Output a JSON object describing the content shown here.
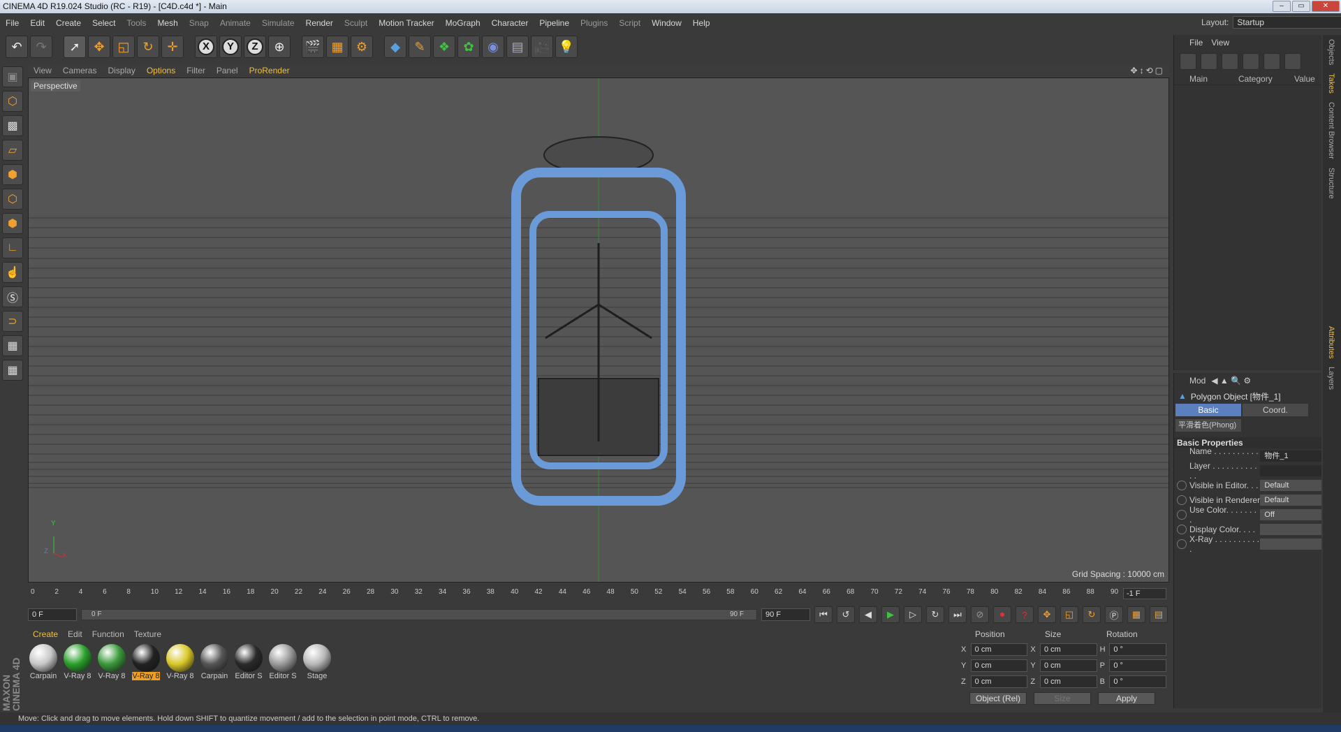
{
  "window": {
    "title": "CINEMA 4D R19.024 Studio (RC - R19) - [C4D.c4d *] - Main",
    "buttons": [
      "–",
      "▭",
      "✕"
    ]
  },
  "menu": [
    "File",
    "Edit",
    "Create",
    "Select",
    "Tools",
    "Mesh",
    "Snap",
    "Animate",
    "Simulate",
    "Render",
    "Sculpt",
    "Motion Tracker",
    "MoGraph",
    "Character",
    "Pipeline",
    "Plugins",
    "Script",
    "Window",
    "Help"
  ],
  "layout": {
    "label": "Layout:",
    "value": "Startup"
  },
  "viewport": {
    "menu": [
      "View",
      "Cameras",
      "Display",
      "Options",
      "Filter",
      "Panel",
      "ProRender"
    ],
    "label": "Perspective",
    "grid_spacing": "Grid Spacing : 10000 cm",
    "axis": {
      "y": "Y",
      "x": "X",
      "z": "Z"
    }
  },
  "timeline": {
    "ticks": [
      "0",
      "2",
      "4",
      "6",
      "8",
      "10",
      "12",
      "14",
      "16",
      "18",
      "20",
      "22",
      "24",
      "26",
      "28",
      "30",
      "32",
      "34",
      "36",
      "38",
      "40",
      "42",
      "44",
      "46",
      "48",
      "50",
      "52",
      "54",
      "56",
      "58",
      "60",
      "62",
      "64",
      "66",
      "68",
      "70",
      "72",
      "74",
      "76",
      "78",
      "80",
      "82",
      "84",
      "86",
      "88",
      "90"
    ],
    "end_field": "-1 F",
    "current": "0 F",
    "scrub_start": "0 F",
    "scrub_end": "90 F",
    "max_field": "90 F"
  },
  "material_manager": {
    "menu": [
      "Create",
      "Edit",
      "Function",
      "Texture"
    ],
    "materials": [
      {
        "label": "Carpain",
        "color": "#c8c8c8"
      },
      {
        "label": "V-Ray 8",
        "color": "#2aa02a"
      },
      {
        "label": "V-Ray 8",
        "color": "#3a9a3a"
      },
      {
        "label": "V-Ray 8",
        "color": "#222222",
        "selected": true
      },
      {
        "label": "V-Ray 8",
        "color": "#d8c828"
      },
      {
        "label": "Carpain",
        "color": "#555555"
      },
      {
        "label": "Editor S",
        "color": "#2a2a2a"
      },
      {
        "label": "Editor S",
        "color": "#9a9a9a"
      },
      {
        "label": "Stage",
        "color": "#b8b8b8"
      }
    ]
  },
  "coordinates": {
    "headers": [
      "Position",
      "Size",
      "Rotation"
    ],
    "rows": [
      {
        "axis": "X",
        "pos": "0 cm",
        "saxis": "X",
        "size": "0 cm",
        "raxis": "H",
        "rot": "0 °"
      },
      {
        "axis": "Y",
        "pos": "0 cm",
        "saxis": "Y",
        "size": "0 cm",
        "raxis": "P",
        "rot": "0 °"
      },
      {
        "axis": "Z",
        "pos": "0 cm",
        "saxis": "Z",
        "size": "0 cm",
        "raxis": "B",
        "rot": "0 °"
      }
    ],
    "mode": "Object (Rel)",
    "size_mode": "Size",
    "apply": "Apply"
  },
  "status": "Move: Click and drag to move elements. Hold down SHIFT to quantize movement / add to the selection in point mode, CTRL to remove.",
  "maxon": "MAXON CINEMA 4D",
  "object_manager": {
    "menu": [
      "File",
      "View"
    ],
    "columns": [
      "Main",
      "Category",
      "Value"
    ]
  },
  "attributes": {
    "menu": "Mod",
    "object": "Polygon Object [物件_1]",
    "tabs": [
      "Basic",
      "Coord."
    ],
    "phong": "平滑着色(Phong)",
    "section": "Basic Properties",
    "props": [
      {
        "label": "Name . . . . . . . . . . . .",
        "value": "物件_1",
        "radio": false
      },
      {
        "label": "Layer . . . . . . . . . . . .",
        "value": "",
        "radio": false
      },
      {
        "label": "Visible in Editor. . .",
        "value": "Default",
        "radio": true
      },
      {
        "label": "Visible in Renderer",
        "value": "Default",
        "radio": true
      },
      {
        "label": "Use Color. . . . . . . .",
        "value": "Off",
        "radio": true
      },
      {
        "label": "Display Color. . . .",
        "value": "",
        "radio": true
      },
      {
        "label": "X-Ray . . . . . . . . . . .",
        "value": "",
        "radio": true
      }
    ]
  },
  "side_tabs": [
    "Objects",
    "Takes",
    "Content Browser",
    "Structure",
    "Attributes",
    "Layers"
  ]
}
